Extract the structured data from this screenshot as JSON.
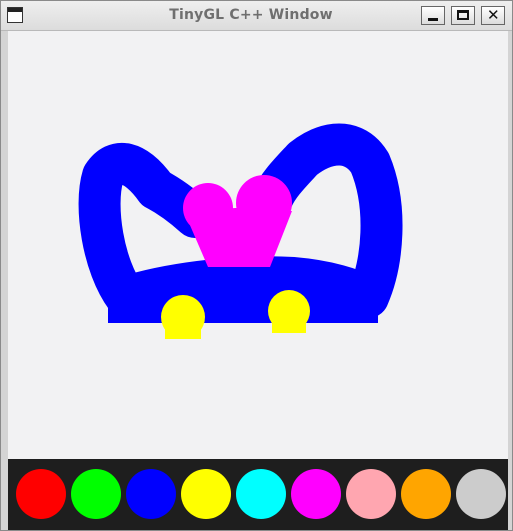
{
  "window": {
    "title": "TinyGL C++ Window",
    "close_glyph": "✕"
  },
  "drawing": {
    "stroke_colors": [
      "#0000ff",
      "#ff00ff",
      "#ffff00"
    ],
    "background": "#f2f2f3"
  },
  "palette": {
    "colors": [
      {
        "name": "red",
        "hex": "#ff0000"
      },
      {
        "name": "green",
        "hex": "#00ff00"
      },
      {
        "name": "blue",
        "hex": "#0000ff"
      },
      {
        "name": "yellow",
        "hex": "#ffff00"
      },
      {
        "name": "cyan",
        "hex": "#00ffff"
      },
      {
        "name": "magenta",
        "hex": "#ff00ff"
      },
      {
        "name": "pink",
        "hex": "#ffa6b0"
      },
      {
        "name": "orange",
        "hex": "#ffa500"
      },
      {
        "name": "gray",
        "hex": "#cccccc"
      }
    ]
  }
}
